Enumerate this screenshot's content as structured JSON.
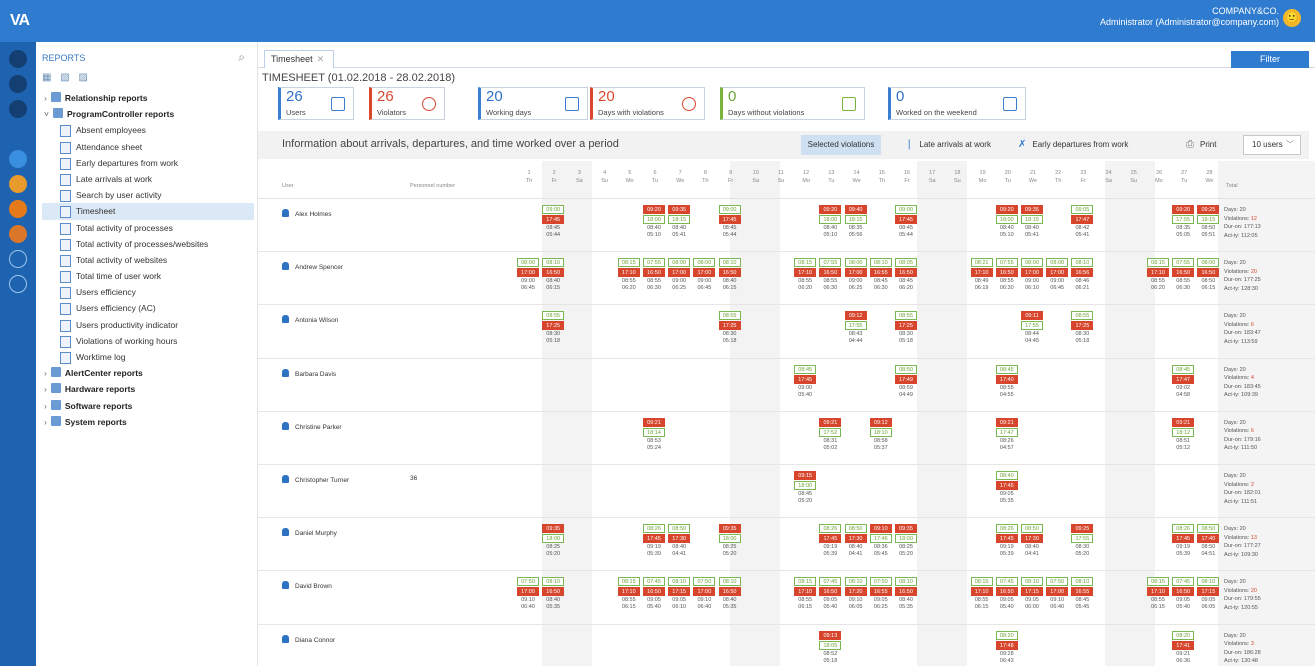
{
  "app": {
    "logo": "VA",
    "company": "COMPANY&CO.",
    "admin": "Administrator (Administrator@company.com)",
    "avatar": "🙂"
  },
  "sidebar": {
    "title": "REPORTS",
    "search": "⌕",
    "tools": "▦ ▧ ▨",
    "items": [
      {
        "kind": "grp",
        "label": "Relationship reports",
        "arrow": "›"
      },
      {
        "kind": "grp",
        "label": "ProgramController reports",
        "arrow": "˅"
      },
      {
        "kind": "leaf",
        "label": "Absent employees"
      },
      {
        "kind": "leaf",
        "label": "Attendance sheet"
      },
      {
        "kind": "leaf",
        "label": "Early departures from work"
      },
      {
        "kind": "leaf",
        "label": "Late arrivals at work"
      },
      {
        "kind": "leaf",
        "label": "Search by user activity"
      },
      {
        "kind": "leaf",
        "label": "Timesheet",
        "selected": true
      },
      {
        "kind": "leaf",
        "label": "Total activity of processes"
      },
      {
        "kind": "leaf",
        "label": "Total activity of processes/websites"
      },
      {
        "kind": "leaf",
        "label": "Total activity of websites"
      },
      {
        "kind": "leaf",
        "label": "Total time of user work"
      },
      {
        "kind": "leaf",
        "label": "Users efficiency"
      },
      {
        "kind": "leaf",
        "label": "Users efficiency (AC)"
      },
      {
        "kind": "leaf",
        "label": "Users productivity indicator"
      },
      {
        "kind": "leaf",
        "label": "Violations of working hours"
      },
      {
        "kind": "leaf",
        "label": "Worktime log"
      },
      {
        "kind": "grp",
        "label": "AlertCenter reports",
        "arrow": "›"
      },
      {
        "kind": "grp",
        "label": "Hardware reports",
        "arrow": "›"
      },
      {
        "kind": "grp",
        "label": "Software reports",
        "arrow": "›"
      },
      {
        "kind": "grp",
        "label": "System reports",
        "arrow": "›"
      }
    ]
  },
  "main": {
    "tab": "Timesheet",
    "tab_close": "✕",
    "filter": "Filter",
    "title": "TIMESHEET (01.02.2018 - 28.02.2018)",
    "cards": [
      {
        "n": "26",
        "l": "Users",
        "c": "c-blue"
      },
      {
        "n": "26",
        "l": "Violators",
        "c": "c-red"
      },
      {
        "n": "20",
        "l": "Working days",
        "c": "c-blue"
      },
      {
        "n": "20",
        "l": "Days with violations",
        "c": "c-red"
      },
      {
        "n": "0",
        "l": "Days without violations",
        "c": "c-green"
      },
      {
        "n": "0",
        "l": "Worked on the weekend",
        "c": "c-blue"
      }
    ],
    "info": "Information about arrivals, departures, and time worked over a period",
    "selected": "Selected violations",
    "late": "Late arrivals at work",
    "early": "Early departures from work",
    "print": "Print",
    "users": "10 users"
  },
  "grid": {
    "h_user": "User",
    "h_pnum": "Personnel number",
    "h_total": "Total",
    "days": [
      [
        "1",
        "Th"
      ],
      [
        "2",
        "Fr"
      ],
      [
        "3",
        "Sa"
      ],
      [
        "4",
        "Su"
      ],
      [
        "5",
        "Mo"
      ],
      [
        "6",
        "Tu"
      ],
      [
        "7",
        "We"
      ],
      [
        "8",
        "Th"
      ],
      [
        "9",
        "Fr"
      ],
      [
        "10",
        "Sa"
      ],
      [
        "11",
        "Su"
      ],
      [
        "12",
        "Mo"
      ],
      [
        "13",
        "Tu"
      ],
      [
        "14",
        "We"
      ],
      [
        "15",
        "Th"
      ],
      [
        "16",
        "Fr"
      ],
      [
        "17",
        "Sa"
      ],
      [
        "18",
        "Su"
      ],
      [
        "19",
        "Mo"
      ],
      [
        "20",
        "Tu"
      ],
      [
        "21",
        "We"
      ],
      [
        "22",
        "Th"
      ],
      [
        "23",
        "Fr"
      ],
      [
        "24",
        "Sa"
      ],
      [
        "25",
        "Su"
      ],
      [
        "26",
        "Mo"
      ],
      [
        "27",
        "Tu"
      ],
      [
        "28",
        "We"
      ]
    ],
    "rows": [
      {
        "name": "Alex Holmes",
        "pnum": "",
        "tot": [
          "Days: 20",
          "Violations: 12",
          "Dur-on: 177:13",
          "Act-ty: 112:05"
        ],
        "e": [
          [
            2,
            "09:00",
            0,
            "17:45",
            1,
            "08:45",
            "05:44"
          ],
          [
            6,
            "09:20",
            1,
            "18:00",
            0,
            "08:40",
            "05:10"
          ],
          [
            7,
            "09:35",
            1,
            "18:15",
            0,
            "08:40",
            "05:41"
          ],
          [
            9,
            "09:00",
            0,
            "17:45",
            1,
            "08:45",
            "05:44"
          ],
          [
            13,
            "09:20",
            1,
            "18:00",
            0,
            "08:40",
            "05:10"
          ],
          [
            14,
            "09:40",
            1,
            "18:15",
            0,
            "08:35",
            "05:56"
          ],
          [
            16,
            "09:00",
            0,
            "17:45",
            1,
            "08:45",
            "05:44"
          ],
          [
            20,
            "09:20",
            1,
            "18:00",
            0,
            "08:40",
            "05:10"
          ],
          [
            21,
            "09:35",
            1,
            "18:15",
            0,
            "08:40",
            "05:41"
          ],
          [
            23,
            "09:05",
            0,
            "17:47",
            1,
            "08:42",
            "05:41"
          ],
          [
            27,
            "09:20",
            1,
            "17:55",
            0,
            "08:35",
            "05:05"
          ],
          [
            28,
            "09:25",
            1,
            "18:15",
            0,
            "08:50",
            "05:51"
          ]
        ]
      },
      {
        "name": "Andrew Spencer",
        "pnum": "",
        "tot": [
          "Days: 20",
          "Violations: 20",
          "Dur-on: 177:25",
          "Act-ty: 128:30"
        ],
        "e": [
          [
            1,
            "08:00",
            0,
            "17:00",
            1,
            "09:00",
            "06:45"
          ],
          [
            2,
            "08:10",
            0,
            "16:50",
            1,
            "08:40",
            "06:15"
          ],
          [
            5,
            "08:15",
            0,
            "17:10",
            1,
            "08:55",
            "06:20"
          ],
          [
            6,
            "07:55",
            0,
            "16:50",
            1,
            "08:55",
            "06:30"
          ],
          [
            7,
            "08:00",
            0,
            "17:00",
            1,
            "09:00",
            "06:25"
          ],
          [
            8,
            "08:00",
            0,
            "17:00",
            1,
            "09:00",
            "06:45"
          ],
          [
            9,
            "08:10",
            0,
            "16:50",
            1,
            "08:40",
            "06:15"
          ],
          [
            12,
            "08:15",
            0,
            "17:10",
            1,
            "08:55",
            "06:20"
          ],
          [
            13,
            "07:55",
            0,
            "16:50",
            1,
            "08:55",
            "06:30"
          ],
          [
            14,
            "08:00",
            0,
            "17:00",
            1,
            "09:00",
            "06:25"
          ],
          [
            15,
            "08:10",
            0,
            "16:55",
            1,
            "08:45",
            "06:30"
          ],
          [
            16,
            "08:05",
            0,
            "16:50",
            1,
            "08:45",
            "06:20"
          ],
          [
            19,
            "08:21",
            0,
            "17:10",
            1,
            "08:49",
            "06:19"
          ],
          [
            20,
            "07:55",
            0,
            "16:50",
            1,
            "08:55",
            "06:30"
          ],
          [
            21,
            "08:00",
            0,
            "17:00",
            1,
            "09:00",
            "06:10"
          ],
          [
            22,
            "08:00",
            0,
            "17:00",
            1,
            "09:00",
            "06:45"
          ],
          [
            23,
            "08:10",
            0,
            "16:56",
            1,
            "08:46",
            "06:21"
          ],
          [
            26,
            "08:15",
            0,
            "17:10",
            1,
            "08:55",
            "06:20"
          ],
          [
            27,
            "07:55",
            0,
            "16:50",
            1,
            "08:55",
            "06:30"
          ],
          [
            28,
            "08:00",
            0,
            "16:50",
            1,
            "08:50",
            "06:15"
          ]
        ]
      },
      {
        "name": "Antonia Wilson",
        "pnum": "",
        "tot": [
          "Days: 20",
          "Violations: 6",
          "Dur-on: 183:47",
          "Act-ty: 113:59"
        ],
        "e": [
          [
            2,
            "08:55",
            0,
            "17:25",
            1,
            "08:30",
            "05:18"
          ],
          [
            9,
            "08:55",
            0,
            "17:25",
            1,
            "08:30",
            "05:18"
          ],
          [
            14,
            "09:12",
            1,
            "17:55",
            0,
            "08:43",
            "04:44"
          ],
          [
            16,
            "08:55",
            0,
            "17:25",
            1,
            "08:30",
            "05:18"
          ],
          [
            21,
            "09:11",
            1,
            "17:55",
            0,
            "08:44",
            "04:45"
          ],
          [
            23,
            "08:55",
            0,
            "17:25",
            1,
            "08:30",
            "05:18"
          ]
        ]
      },
      {
        "name": "Barbara Davis",
        "pnum": "",
        "tot": [
          "Days: 20",
          "Violations: 4",
          "Dur-on: 183:45",
          "Act-ty: 109:39"
        ],
        "e": [
          [
            12,
            "08:45",
            0,
            "17:45",
            1,
            "09:00",
            "05:40"
          ],
          [
            16,
            "08:50",
            0,
            "17:49",
            1,
            "08:59",
            "04:49"
          ],
          [
            20,
            "08:45",
            0,
            "17:40",
            1,
            "08:55",
            "04:55"
          ],
          [
            27,
            "08:45",
            0,
            "17:47",
            1,
            "09:02",
            "04:58"
          ]
        ]
      },
      {
        "name": "Christine Parker",
        "pnum": "",
        "tot": [
          "Days: 20",
          "Violations: 6",
          "Dur-on: 179:16",
          "Act-ty: 111:50"
        ],
        "e": [
          [
            6,
            "09:21",
            1,
            "18:14",
            0,
            "08:53",
            "05:24"
          ],
          [
            13,
            "09:21",
            1,
            "17:52",
            0,
            "08:31",
            "05:02"
          ],
          [
            15,
            "09:12",
            1,
            "18:10",
            0,
            "08:58",
            "05:37"
          ],
          [
            20,
            "09:21",
            1,
            "17:47",
            0,
            "08:26",
            "04:57"
          ],
          [
            27,
            "09:21",
            1,
            "18:12",
            0,
            "08:51",
            "05:12"
          ]
        ]
      },
      {
        "name": "Christopher Turner",
        "pnum": "36",
        "tot": [
          "Days: 20",
          "Violations: 2",
          "Dur-on: 182:01",
          "Act-ty: 111:51"
        ],
        "e": [
          [
            12,
            "09:15",
            1,
            "18:00",
            0,
            "08:45",
            "05:20"
          ],
          [
            20,
            "08:40",
            0,
            "17:45",
            1,
            "09:05",
            "05:35"
          ]
        ]
      },
      {
        "name": "Daniel Murphy",
        "pnum": "",
        "tot": [
          "Days: 20",
          "Violations: 13",
          "Dur-on: 177:27",
          "Act-ty: 109:30"
        ],
        "e": [
          [
            2,
            "09:35",
            1,
            "18:00",
            0,
            "08:25",
            "05:20"
          ],
          [
            6,
            "08:26",
            0,
            "17:45",
            1,
            "09:19",
            "05:39"
          ],
          [
            7,
            "08:50",
            0,
            "17:30",
            1,
            "08:40",
            "04:41"
          ],
          [
            9,
            "09:35",
            1,
            "18:00",
            0,
            "08:25",
            "05:20"
          ],
          [
            13,
            "08:26",
            0,
            "17:45",
            1,
            "09:19",
            "05:39"
          ],
          [
            14,
            "08:50",
            0,
            "17:30",
            1,
            "08:40",
            "04:41"
          ],
          [
            15,
            "09:10",
            1,
            "17:46",
            0,
            "08:36",
            "05:45"
          ],
          [
            16,
            "09:35",
            1,
            "18:00",
            0,
            "08:25",
            "05:20"
          ],
          [
            20,
            "08:26",
            0,
            "17:45",
            1,
            "09:19",
            "05:39"
          ],
          [
            21,
            "08:50",
            0,
            "17:30",
            1,
            "08:40",
            "04:41"
          ],
          [
            23,
            "09:25",
            1,
            "17:55",
            0,
            "08:30",
            "05:20"
          ],
          [
            27,
            "08:26",
            0,
            "17:45",
            1,
            "09:19",
            "05:39"
          ],
          [
            28,
            "08:50",
            0,
            "17:40",
            1,
            "08:50",
            "04:51"
          ]
        ]
      },
      {
        "name": "David Brown",
        "pnum": "",
        "tot": [
          "Days: 20",
          "Violations: 20",
          "Dur-on: 179:55",
          "Act-ty: 120:55"
        ],
        "e": [
          [
            1,
            "07:50",
            0,
            "17:00",
            1,
            "09:10",
            "06:40"
          ],
          [
            2,
            "08:10",
            0,
            "16:50",
            1,
            "08:40",
            "05:35"
          ],
          [
            5,
            "08:15",
            0,
            "17:10",
            1,
            "08:55",
            "06:15"
          ],
          [
            6,
            "07:45",
            0,
            "16:50",
            1,
            "09:05",
            "05:40"
          ],
          [
            7,
            "08:10",
            0,
            "17:15",
            1,
            "09:05",
            "06:10"
          ],
          [
            8,
            "07:50",
            0,
            "17:00",
            1,
            "09:10",
            "06:40"
          ],
          [
            9,
            "08:10",
            0,
            "16:50",
            1,
            "08:40",
            "05:35"
          ],
          [
            12,
            "08:15",
            0,
            "17:10",
            1,
            "08:55",
            "06:15"
          ],
          [
            13,
            "07:45",
            0,
            "16:50",
            1,
            "09:05",
            "05:40"
          ],
          [
            14,
            "08:10",
            0,
            "17:20",
            1,
            "09:10",
            "06:05"
          ],
          [
            15,
            "07:50",
            0,
            "16:55",
            1,
            "09:05",
            "06:25"
          ],
          [
            16,
            "08:10",
            0,
            "16:50",
            1,
            "08:40",
            "05:35"
          ],
          [
            19,
            "08:15",
            0,
            "17:10",
            1,
            "08:55",
            "06:15"
          ],
          [
            20,
            "07:45",
            0,
            "16:50",
            1,
            "09:05",
            "05:40"
          ],
          [
            21,
            "08:10",
            0,
            "17:15",
            1,
            "09:05",
            "06:00"
          ],
          [
            22,
            "07:50",
            0,
            "17:00",
            1,
            "09:10",
            "06:40"
          ],
          [
            23,
            "08:10",
            0,
            "16:55",
            1,
            "08:45",
            "05:45"
          ],
          [
            26,
            "08:15",
            0,
            "17:10",
            1,
            "08:55",
            "06:15"
          ],
          [
            27,
            "07:45",
            0,
            "16:50",
            1,
            "09:05",
            "05:40"
          ],
          [
            28,
            "08:10",
            0,
            "17:15",
            1,
            "09:05",
            "06:05"
          ]
        ]
      },
      {
        "name": "Diana Connor",
        "pnum": "",
        "tot": [
          "Days: 20",
          "Violations: 3",
          "Dur-on: 186:28",
          "Act-ty: 130:48"
        ],
        "e": [
          [
            13,
            "09:13",
            1,
            "18:05",
            0,
            "08:52",
            "05:18"
          ],
          [
            20,
            "08:20",
            0,
            "17:48",
            1,
            "09:28",
            "06:43"
          ],
          [
            27,
            "08:20",
            0,
            "17:41",
            1,
            "09:21",
            "06:36"
          ]
        ]
      }
    ]
  }
}
